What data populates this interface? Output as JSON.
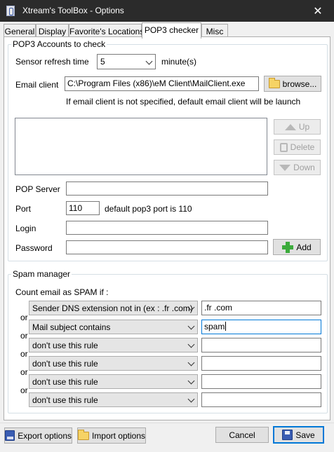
{
  "window": {
    "title": "Xtream's ToolBox - Options",
    "close_glyph": "✕"
  },
  "tabs": [
    {
      "label": "General"
    },
    {
      "label": "Display"
    },
    {
      "label": "Favorite's Locations"
    },
    {
      "label": "POP3 checker",
      "active": true
    },
    {
      "label": "Misc"
    }
  ],
  "pop3": {
    "group_title": "POP3 Accounts to check",
    "sensor_label": "Sensor refresh time",
    "sensor_value": "5",
    "sensor_unit": "minute(s)",
    "email_client_label": "Email client",
    "email_client_value": "C:\\Program Files (x86)\\eM Client\\MailClient.exe",
    "browse_label": "browse...",
    "email_client_hint": "If email client is not specified, default email client will be launch",
    "up_label": "Up",
    "delete_label": "Delete",
    "down_label": "Down",
    "pop_server_label": "POP Server",
    "pop_server_value": "",
    "port_label": "Port",
    "port_value": "110",
    "port_hint": "default pop3 port is 110",
    "login_label": "Login",
    "login_value": "",
    "password_label": "Password",
    "password_value": "",
    "add_label": "Add"
  },
  "spam": {
    "group_title": "Spam manager",
    "intro": "Count email as SPAM if :",
    "connector": "or",
    "rules": [
      {
        "rule": "Sender DNS extension not in (ex : .fr .com)",
        "value": ".fr .com"
      },
      {
        "rule": "Mail subject contains",
        "value": "spam"
      },
      {
        "rule": "don't use this rule",
        "value": ""
      },
      {
        "rule": "don't use this rule",
        "value": ""
      },
      {
        "rule": "don't use this rule",
        "value": ""
      },
      {
        "rule": "don't use this rule",
        "value": ""
      }
    ]
  },
  "footer": {
    "export_label": "Export options",
    "import_label": "Import options",
    "cancel_label": "Cancel",
    "save_label": "Save"
  }
}
